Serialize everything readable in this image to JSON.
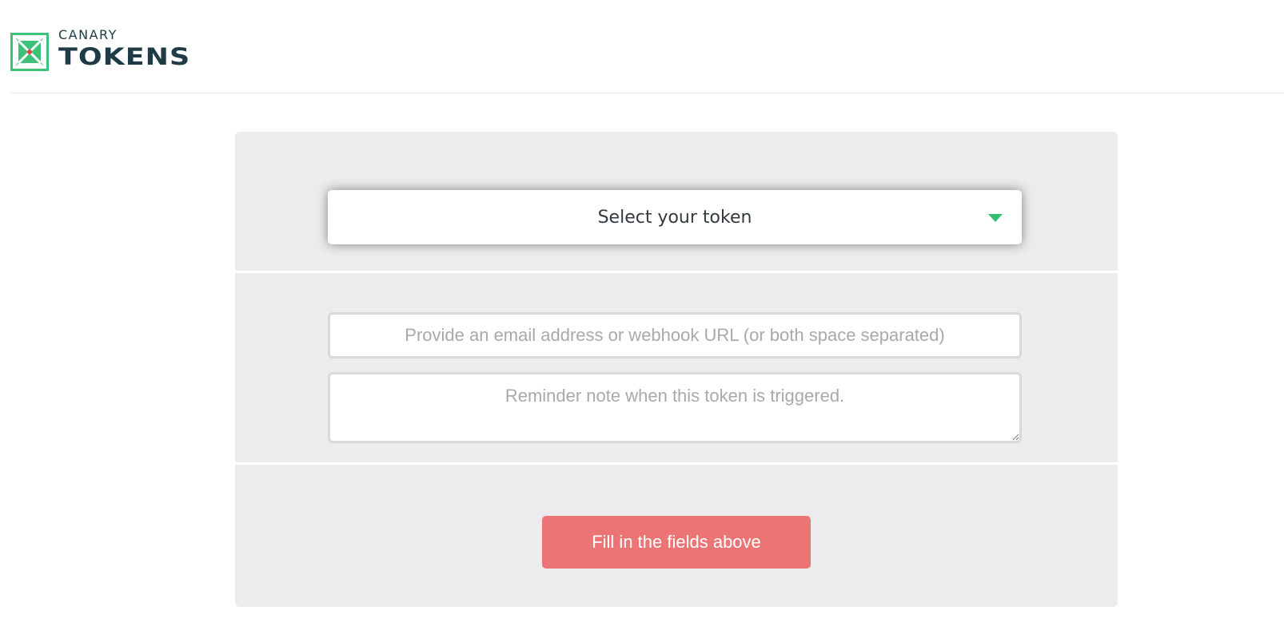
{
  "logo": {
    "small_text": "CANARY",
    "big_text": "TOKENS",
    "icon": "canary-logo-icon"
  },
  "token_select": {
    "label": "Select your token",
    "caret_icon": "chevron-down-icon"
  },
  "email_input": {
    "placeholder": "Provide an email address or webhook URL (or both space separated)",
    "value": ""
  },
  "memo_input": {
    "placeholder": "Reminder note when this token is triggered.",
    "value": ""
  },
  "submit": {
    "label": "Fill in the fields above"
  },
  "colors": {
    "brand_green": "#2fbf71",
    "brand_dark": "#1f3c46",
    "button_red": "#ec7474",
    "card_bg": "#ececee"
  }
}
